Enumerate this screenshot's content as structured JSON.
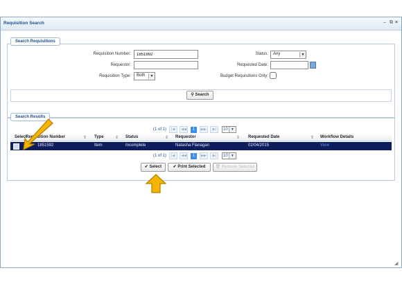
{
  "window": {
    "title": "Requisition Search",
    "controls": {
      "minimize": "–",
      "restore": "⧉",
      "close": "×"
    }
  },
  "search_panel": {
    "legend": "Search Requisitions",
    "labels": {
      "req_number": "Requisition Number:",
      "requestor": "Requestor:",
      "req_type": "Requisition Type:",
      "status": "Status:",
      "requested_date": "Requested Date:",
      "budget_only": "Budget Requisitions Only:"
    },
    "values": {
      "req_number": "1851992",
      "requestor": "",
      "req_type": "Both",
      "status": "Any",
      "requested_date": ""
    },
    "search_button": "Search",
    "search_icon": "magnifier-icon"
  },
  "results_panel": {
    "legend": "Search Results",
    "pager": {
      "text": "(1 of 1)",
      "current_page": "1",
      "page_size": "10"
    },
    "columns": [
      "Select",
      "Requisition Number",
      "Type",
      "Status",
      "Requestor",
      "Requested Date",
      "Workflow Details"
    ],
    "rows": [
      {
        "req_number": "1851592",
        "type": "Item",
        "status": "Incomplete",
        "requestor": "Natasha Flanagan",
        "date": "02/04/2015",
        "workflow": "View"
      }
    ],
    "buttons": {
      "select": "Select",
      "print_selected": "Print Selected",
      "remove_selected": "Remove Selected"
    }
  },
  "colors": {
    "accent": "#1f4e8c",
    "selected_row": "#0f1d5e",
    "arrow": "#f4b400"
  }
}
